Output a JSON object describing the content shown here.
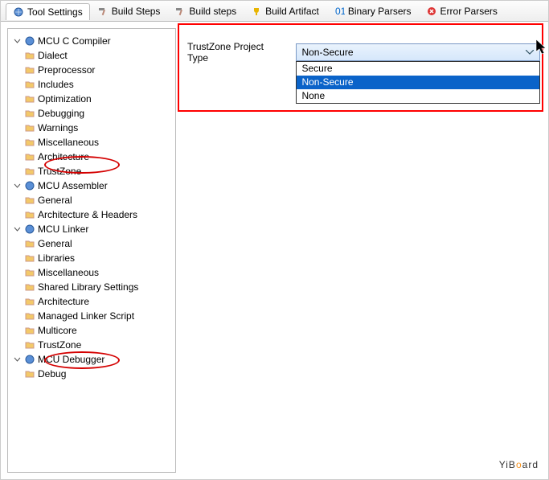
{
  "tabs": [
    {
      "label": "Tool Settings",
      "icon": "gear-globe"
    },
    {
      "label": "Build Steps",
      "icon": "hammer"
    },
    {
      "label": "Build steps",
      "icon": "hammer"
    },
    {
      "label": "Build Artifact",
      "icon": "trophy"
    },
    {
      "label": "Binary Parsers",
      "icon": "binary"
    },
    {
      "label": "Error Parsers",
      "icon": "error"
    }
  ],
  "tree": {
    "mcu_c_compiler": "MCU C Compiler",
    "dialect": "Dialect",
    "preprocessor": "Preprocessor",
    "includes": "Includes",
    "optimization": "Optimization",
    "debugging": "Debugging",
    "warnings": "Warnings",
    "miscellaneous1": "Miscellaneous",
    "architecture1": "Architecture",
    "trustzone1": "TrustZone",
    "mcu_assembler": "MCU Assembler",
    "general1": "General",
    "arch_headers": "Architecture & Headers",
    "mcu_linker": "MCU Linker",
    "general2": "General",
    "libraries": "Libraries",
    "miscellaneous2": "Miscellaneous",
    "shared_lib": "Shared Library Settings",
    "architecture2": "Architecture",
    "managed_linker": "Managed Linker Script",
    "multicore": "Multicore",
    "trustzone2": "TrustZone",
    "mcu_debugger": "MCU Debugger",
    "debug": "Debug"
  },
  "form": {
    "label": "TrustZone Project Type",
    "selected": "Non-Secure",
    "options": [
      "Secure",
      "Non-Secure",
      "None"
    ]
  },
  "watermark": {
    "y": "Y",
    "i": "i",
    "b": "B",
    "o": "o",
    "a": "a",
    "r": "r",
    "d": "d"
  }
}
